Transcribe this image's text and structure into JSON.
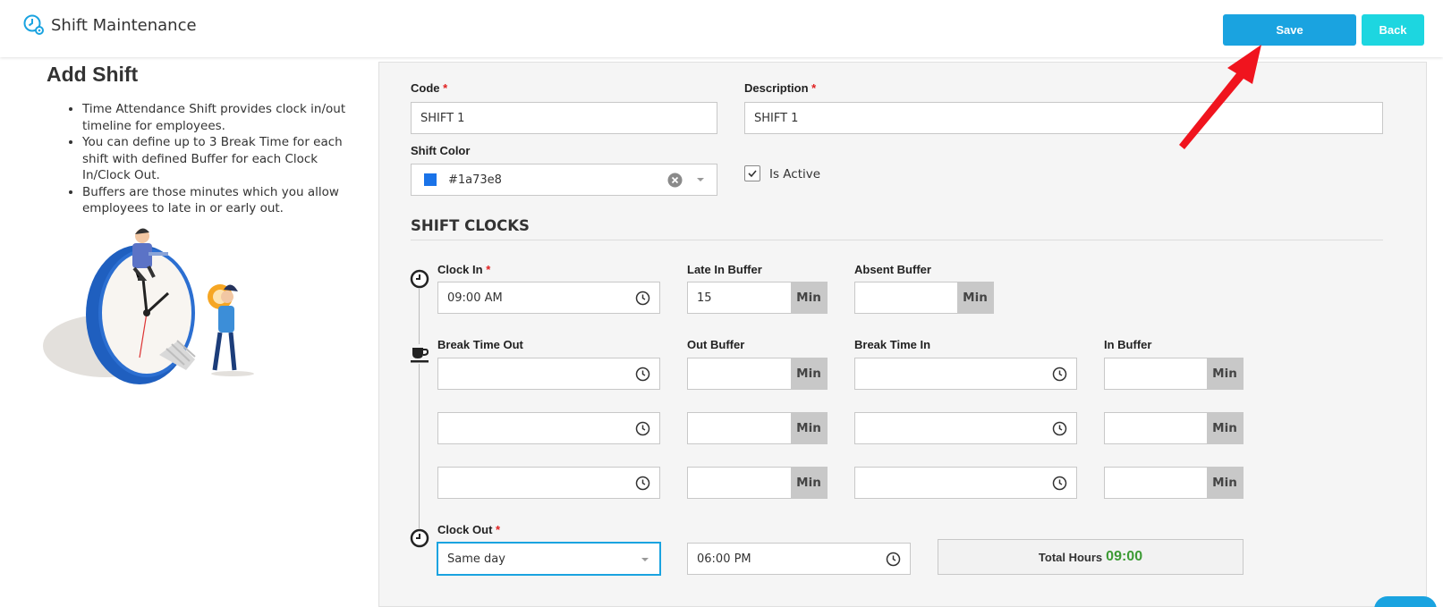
{
  "header": {
    "title": "Shift Maintenance",
    "save_label": "Save",
    "back_label": "Back"
  },
  "info": {
    "title": "Add Shift",
    "bullets": [
      "Time Attendance Shift provides clock in/out timeline for employees.",
      "You can define up to 3 Break Time for each shift with defined Buffer for each Clock In/Clock Out.",
      "Buffers are those minutes which you allow employees to late in or early out."
    ]
  },
  "form": {
    "code_label": "Code",
    "code_value": "SHIFT 1",
    "description_label": "Description",
    "description_value": "SHIFT 1",
    "shift_color_label": "Shift Color",
    "shift_color_value": "#1a73e8",
    "is_active_label": "Is Active",
    "is_active_checked": true,
    "required_mark": "*"
  },
  "shift_clocks": {
    "title": "SHIFT CLOCKS",
    "clock_in_label": "Clock In",
    "clock_in_value": "09:00  AM",
    "late_in_buffer_label": "Late In Buffer",
    "late_in_buffer_value": "15",
    "absent_buffer_label": "Absent Buffer",
    "absent_buffer_value": "",
    "min_unit": "Min",
    "break_time_out_label": "Break Time Out",
    "out_buffer_label": "Out Buffer",
    "break_time_in_label": "Break Time In",
    "in_buffer_label": "In Buffer",
    "clock_out_label": "Clock Out",
    "clock_out_day_value": "Same day",
    "clock_out_time_value": "06:00  PM",
    "total_hours_label": "Total Hours",
    "total_hours_value": "09:00"
  },
  "colors": {
    "accent": "#1aa3e0",
    "back_button": "#1dd6e0",
    "total_hours": "#3d9b35",
    "required": "#e02020",
    "annotation_arrow": "#f0141e"
  }
}
